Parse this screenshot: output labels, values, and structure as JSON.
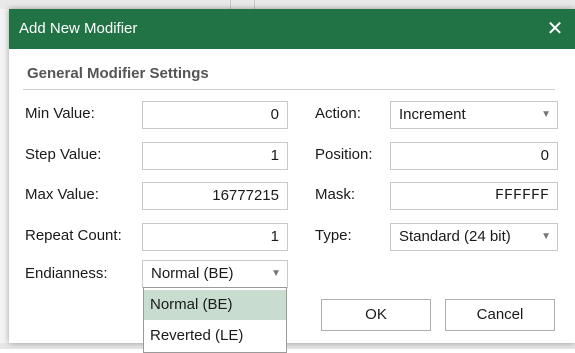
{
  "dialog": {
    "title": "Add New Modifier",
    "close_glyph": "✕",
    "group_title": "General Modifier Settings"
  },
  "fields": {
    "min_value": {
      "label": "Min Value:",
      "value": "0"
    },
    "step_value": {
      "label": "Step Value:",
      "value": "1"
    },
    "max_value": {
      "label": "Max Value:",
      "value": "16777215"
    },
    "repeat_count": {
      "label": "Repeat Count:",
      "value": "1"
    },
    "endianness": {
      "label": "Endianness:",
      "value": "Normal (BE)"
    },
    "action": {
      "label": "Action:",
      "value": "Increment"
    },
    "position": {
      "label": "Position:",
      "value": "0"
    },
    "mask": {
      "label": "Mask:",
      "value": "FFFFFF"
    },
    "type": {
      "label": "Type:",
      "value": "Standard (24 bit)"
    }
  },
  "endianness_options": [
    "Normal (BE)",
    "Reverted (LE)"
  ],
  "buttons": {
    "ok": "OK",
    "cancel": "Cancel"
  },
  "icons": {
    "close": "close-icon",
    "dropdown": "chevron-down-icon"
  },
  "colors": {
    "titlebar": "#217346",
    "selected_option": "#c8ddd0"
  }
}
